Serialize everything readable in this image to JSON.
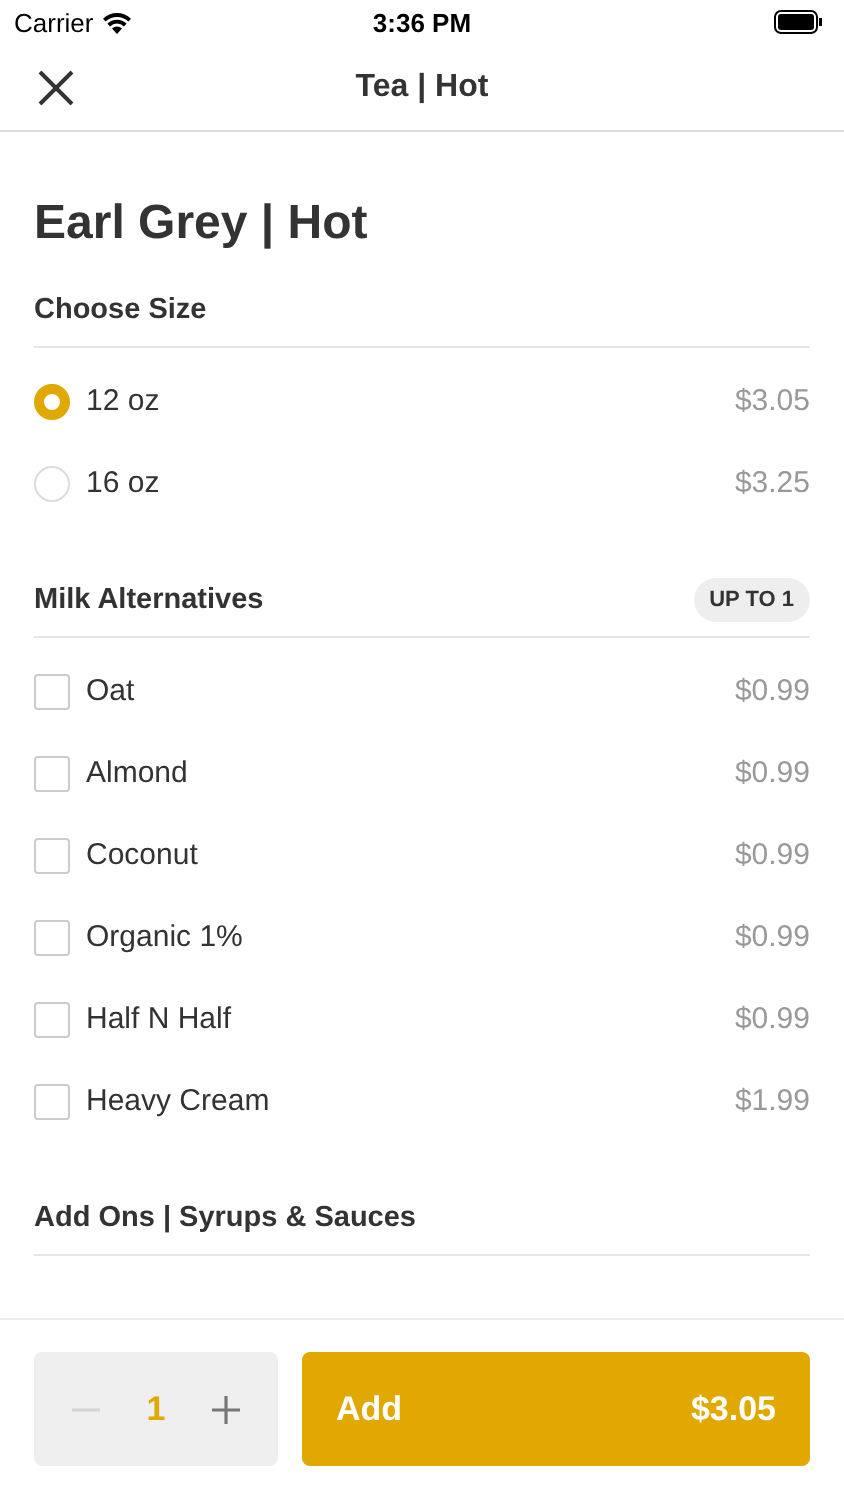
{
  "status_bar": {
    "carrier": "Carrier",
    "time": "3:36 PM"
  },
  "nav": {
    "title": "Tea | Hot"
  },
  "item_title": "Earl Grey | Hot",
  "sections": [
    {
      "title": "Choose Size",
      "kind": "radio",
      "options": [
        {
          "label": "12 oz",
          "price": "$3.05",
          "selected": true
        },
        {
          "label": "16 oz",
          "price": "$3.25",
          "selected": false
        }
      ]
    },
    {
      "title": "Milk Alternatives",
      "badge": "UP TO 1",
      "kind": "checkbox",
      "options": [
        {
          "label": "Oat",
          "price": "$0.99",
          "checked": false
        },
        {
          "label": "Almond",
          "price": "$0.99",
          "checked": false
        },
        {
          "label": "Coconut",
          "price": "$0.99",
          "checked": false
        },
        {
          "label": "Organic 1%",
          "price": "$0.99",
          "checked": false
        },
        {
          "label": "Half N Half",
          "price": "$0.99",
          "checked": false
        },
        {
          "label": "Heavy Cream",
          "price": "$1.99",
          "checked": false
        }
      ]
    },
    {
      "title": "Add Ons | Syrups & Sauces"
    }
  ],
  "footer": {
    "quantity": "1",
    "decrement_disabled": true,
    "add_label": "Add",
    "total": "$3.05"
  }
}
